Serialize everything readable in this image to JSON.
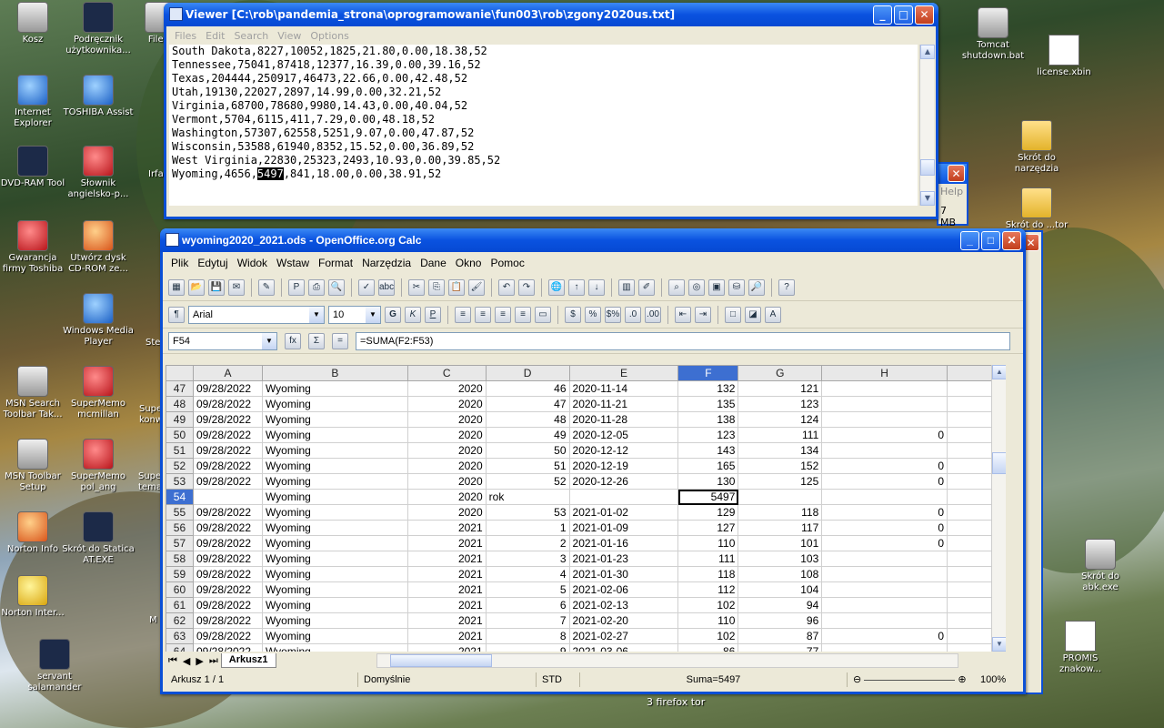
{
  "desktop": {
    "icons_left": [
      {
        "label": "Kosz",
        "name": "recycle-bin-icon",
        "x": 0,
        "y": 0
      },
      {
        "label": "Podręcznik użytkownika...",
        "name": "manual-icon"
      },
      {
        "label": "File E",
        "name": "file-explorer-icon"
      },
      {
        "label": "Internet Explorer",
        "name": "ie-icon"
      },
      {
        "label": "TOSHIBA Assist",
        "name": "toshiba-assist-icon"
      },
      {
        "label": "DVD-RAM Tool",
        "name": "dvd-ram-icon"
      },
      {
        "label": "Słownik angielsko-p...",
        "name": "dictionary-icon"
      },
      {
        "label": "Gwarancja firmy Toshiba",
        "name": "warranty-icon"
      },
      {
        "label": "Utwórz dysk CD-ROM ze...",
        "name": "cdrom-icon"
      },
      {
        "label": "Windows Media Player",
        "name": "media-player-icon"
      },
      {
        "label": "MSN Search Toolbar Tak...",
        "name": "msn-search-icon"
      },
      {
        "label": "SuperMemo mcmillan",
        "name": "supermemo-mcmillan-icon"
      },
      {
        "label": "MSN Toolbar Setup",
        "name": "msn-toolbar-icon"
      },
      {
        "label": "SuperMemo pol_ang",
        "name": "supermemo-polang-icon"
      },
      {
        "label": "Norton Info",
        "name": "norton-info-icon"
      },
      {
        "label": "Skrót do Statica AT.EXE",
        "name": "statica-icon"
      },
      {
        "label": "Norton Inter...",
        "name": "norton-inter-icon"
      },
      {
        "label": "servant salamander",
        "name": "salamander-icon"
      }
    ],
    "partial_labels": [
      "Irfa",
      "Ste",
      "Supe konw",
      "Supe tema",
      "M"
    ],
    "icons_right": [
      {
        "label": "Tomcat shutdown.bat"
      },
      {
        "label": "license.xbin"
      },
      {
        "label": "Skrót do narzędzia"
      },
      {
        "label": "Skrót do ...tor"
      },
      {
        "label": "Skrót do abk.exe"
      },
      {
        "label": "PROMIS znakow..."
      }
    ],
    "taskbar_hint": "3 firefox tor"
  },
  "viewer": {
    "title": "Viewer [C:\\rob\\pandemia_strona\\oprogramowanie\\fun003\\rob\\zgony2020us.txt]",
    "menu": [
      "Files",
      "Edit",
      "Search",
      "View",
      "Options"
    ],
    "lines_before": [
      "South Dakota,8227,10052,1825,21.80,0.00,18.38,52",
      "Tennessee,75041,87418,12377,16.39,0.00,39.16,52",
      "Texas,204444,250917,46473,22.66,0.00,42.48,52",
      "Utah,19130,22027,2897,14.99,0.00,32.21,52",
      "Virginia,68700,78680,9980,14.43,0.00,40.04,52",
      "Vermont,5704,6115,411,7.29,0.00,48.18,52",
      "Washington,57307,62558,5251,9.07,0.00,47.87,52",
      "Wisconsin,53588,61940,8352,15.52,0.00,36.89,52",
      "West Virginia,22830,25323,2493,10.93,0.00,39.85,52"
    ],
    "last_line_pre": "Wyoming,4656,",
    "last_line_selected": "5497",
    "last_line_post": ",841,18.00,0.00,38.91,52"
  },
  "behind_window": {
    "help": "Help",
    "size": "7 MB"
  },
  "calc": {
    "title": "wyoming2020_2021.ods - OpenOffice.org Calc",
    "menu": [
      "Plik",
      "Edytuj",
      "Widok",
      "Wstaw",
      "Format",
      "Narzędzia",
      "Dane",
      "Okno",
      "Pomoc"
    ],
    "font_name": "Arial",
    "font_size": "10",
    "name_box": "F54",
    "formula": "=SUMA(F2:F53)",
    "columns": [
      "A",
      "B",
      "C",
      "D",
      "E",
      "F",
      "G",
      "H"
    ],
    "rows": [
      {
        "n": "47",
        "a": "09/28/2022",
        "b": "Wyoming",
        "c": "2020",
        "d": "46",
        "e": "2020-11-14",
        "f": "132",
        "g": "121",
        "h": ""
      },
      {
        "n": "48",
        "a": "09/28/2022",
        "b": "Wyoming",
        "c": "2020",
        "d": "47",
        "e": "2020-11-21",
        "f": "135",
        "g": "123",
        "h": ""
      },
      {
        "n": "49",
        "a": "09/28/2022",
        "b": "Wyoming",
        "c": "2020",
        "d": "48",
        "e": "2020-11-28",
        "f": "138",
        "g": "124",
        "h": ""
      },
      {
        "n": "50",
        "a": "09/28/2022",
        "b": "Wyoming",
        "c": "2020",
        "d": "49",
        "e": "2020-12-05",
        "f": "123",
        "g": "111",
        "h": "0"
      },
      {
        "n": "51",
        "a": "09/28/2022",
        "b": "Wyoming",
        "c": "2020",
        "d": "50",
        "e": "2020-12-12",
        "f": "143",
        "g": "134",
        "h": ""
      },
      {
        "n": "52",
        "a": "09/28/2022",
        "b": "Wyoming",
        "c": "2020",
        "d": "51",
        "e": "2020-12-19",
        "f": "165",
        "g": "152",
        "h": "0"
      },
      {
        "n": "53",
        "a": "09/28/2022",
        "b": "Wyoming",
        "c": "2020",
        "d": "52",
        "e": "2020-12-26",
        "f": "130",
        "g": "125",
        "h": "0"
      },
      {
        "n": "54",
        "a": "",
        "b": "Wyoming",
        "c": "2020",
        "d": "rok",
        "e": "",
        "f": "5497",
        "g": "",
        "h": ""
      },
      {
        "n": "55",
        "a": "09/28/2022",
        "b": "Wyoming",
        "c": "2020",
        "d": "53",
        "e": "2021-01-02",
        "f": "129",
        "g": "118",
        "h": "0"
      },
      {
        "n": "56",
        "a": "09/28/2022",
        "b": "Wyoming",
        "c": "2021",
        "d": "1",
        "e": "2021-01-09",
        "f": "127",
        "g": "117",
        "h": "0"
      },
      {
        "n": "57",
        "a": "09/28/2022",
        "b": "Wyoming",
        "c": "2021",
        "d": "2",
        "e": "2021-01-16",
        "f": "110",
        "g": "101",
        "h": "0"
      },
      {
        "n": "58",
        "a": "09/28/2022",
        "b": "Wyoming",
        "c": "2021",
        "d": "3",
        "e": "2021-01-23",
        "f": "111",
        "g": "103",
        "h": ""
      },
      {
        "n": "59",
        "a": "09/28/2022",
        "b": "Wyoming",
        "c": "2021",
        "d": "4",
        "e": "2021-01-30",
        "f": "118",
        "g": "108",
        "h": ""
      },
      {
        "n": "60",
        "a": "09/28/2022",
        "b": "Wyoming",
        "c": "2021",
        "d": "5",
        "e": "2021-02-06",
        "f": "112",
        "g": "104",
        "h": ""
      },
      {
        "n": "61",
        "a": "09/28/2022",
        "b": "Wyoming",
        "c": "2021",
        "d": "6",
        "e": "2021-02-13",
        "f": "102",
        "g": "94",
        "h": ""
      },
      {
        "n": "62",
        "a": "09/28/2022",
        "b": "Wyoming",
        "c": "2021",
        "d": "7",
        "e": "2021-02-20",
        "f": "110",
        "g": "96",
        "h": ""
      },
      {
        "n": "63",
        "a": "09/28/2022",
        "b": "Wyoming",
        "c": "2021",
        "d": "8",
        "e": "2021-02-27",
        "f": "102",
        "g": "87",
        "h": "0"
      },
      {
        "n": "64",
        "a": "09/28/2022",
        "b": "Wyoming",
        "c": "2021",
        "d": "9",
        "e": "2021-03-06",
        "f": "86",
        "g": "77",
        "h": ""
      }
    ],
    "sheet_tab": "Arkusz1",
    "status": {
      "sheet": "Arkusz 1 / 1",
      "style": "Domyślnie",
      "mode": "STD",
      "sum": "Suma=5497",
      "zoom": "100%"
    }
  }
}
